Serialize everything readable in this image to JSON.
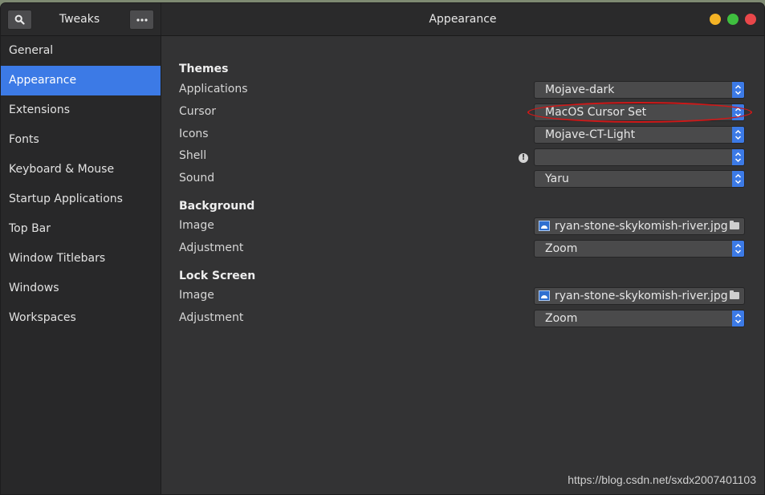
{
  "header": {
    "app_title": "Tweaks",
    "page_title": "Appearance",
    "window_controls": [
      "minimize",
      "maximize",
      "close"
    ],
    "colors": {
      "minimize": "#f4b325",
      "maximize": "#3fbf3f",
      "close": "#e9474a"
    }
  },
  "sidebar": {
    "items": [
      {
        "label": "General"
      },
      {
        "label": "Appearance",
        "active": true
      },
      {
        "label": "Extensions"
      },
      {
        "label": "Fonts"
      },
      {
        "label": "Keyboard & Mouse"
      },
      {
        "label": "Startup Applications"
      },
      {
        "label": "Top Bar"
      },
      {
        "label": "Window Titlebars"
      },
      {
        "label": "Windows"
      },
      {
        "label": "Workspaces"
      }
    ]
  },
  "themes": {
    "title": "Themes",
    "applications": {
      "label": "Applications",
      "value": "Mojave-dark"
    },
    "cursor": {
      "label": "Cursor",
      "value": "MacOS Cursor Set"
    },
    "icons": {
      "label": "Icons",
      "value": "Mojave-CT-Light"
    },
    "shell": {
      "label": "Shell",
      "value": ""
    },
    "sound": {
      "label": "Sound",
      "value": "Yaru"
    }
  },
  "background": {
    "title": "Background",
    "image": {
      "label": "Image",
      "value": "ryan-stone-skykomish-river.jpg"
    },
    "adjustment": {
      "label": "Adjustment",
      "value": "Zoom"
    }
  },
  "lock_screen": {
    "title": "Lock Screen",
    "image": {
      "label": "Image",
      "value": "ryan-stone-skykomish-river.jpg"
    },
    "adjustment": {
      "label": "Adjustment",
      "value": "Zoom"
    }
  },
  "watermark": "https://blog.csdn.net/sxdx2007401103",
  "accent_color": "#3c7ae6"
}
